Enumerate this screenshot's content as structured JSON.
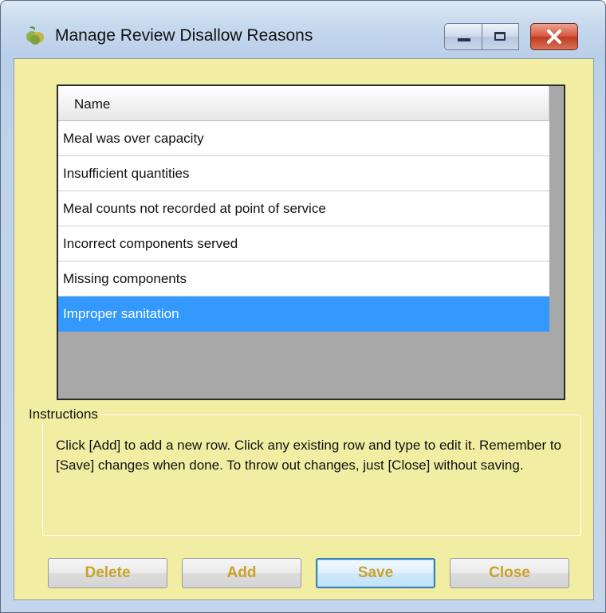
{
  "window": {
    "title": "Manage Review Disallow Reasons"
  },
  "grid": {
    "column_header": "Name",
    "rows": [
      {
        "name": "Meal was over capacity",
        "selected": false
      },
      {
        "name": "Insufficient quantities",
        "selected": false
      },
      {
        "name": "Meal counts not recorded at point of service",
        "selected": false
      },
      {
        "name": "Incorrect components served",
        "selected": false
      },
      {
        "name": "Missing components",
        "selected": false
      },
      {
        "name": "Improper sanitation",
        "selected": true
      }
    ]
  },
  "instructions": {
    "legend": "Instructions",
    "text": "Click [Add] to add a new row.  Click any existing row and type to edit it.  Remember to [Save] changes when done.  To throw out changes, just [Close] without saving."
  },
  "buttons": {
    "delete": "Delete",
    "add": "Add",
    "save": "Save",
    "close": "Close"
  },
  "colors": {
    "client_background": "#f1eda3",
    "selection": "#3399ff",
    "button_text": "#c9a32a"
  },
  "icons": {
    "app": "fruit-icon",
    "minimize": "minimize-icon",
    "maximize": "maximize-icon",
    "close": "close-icon"
  }
}
